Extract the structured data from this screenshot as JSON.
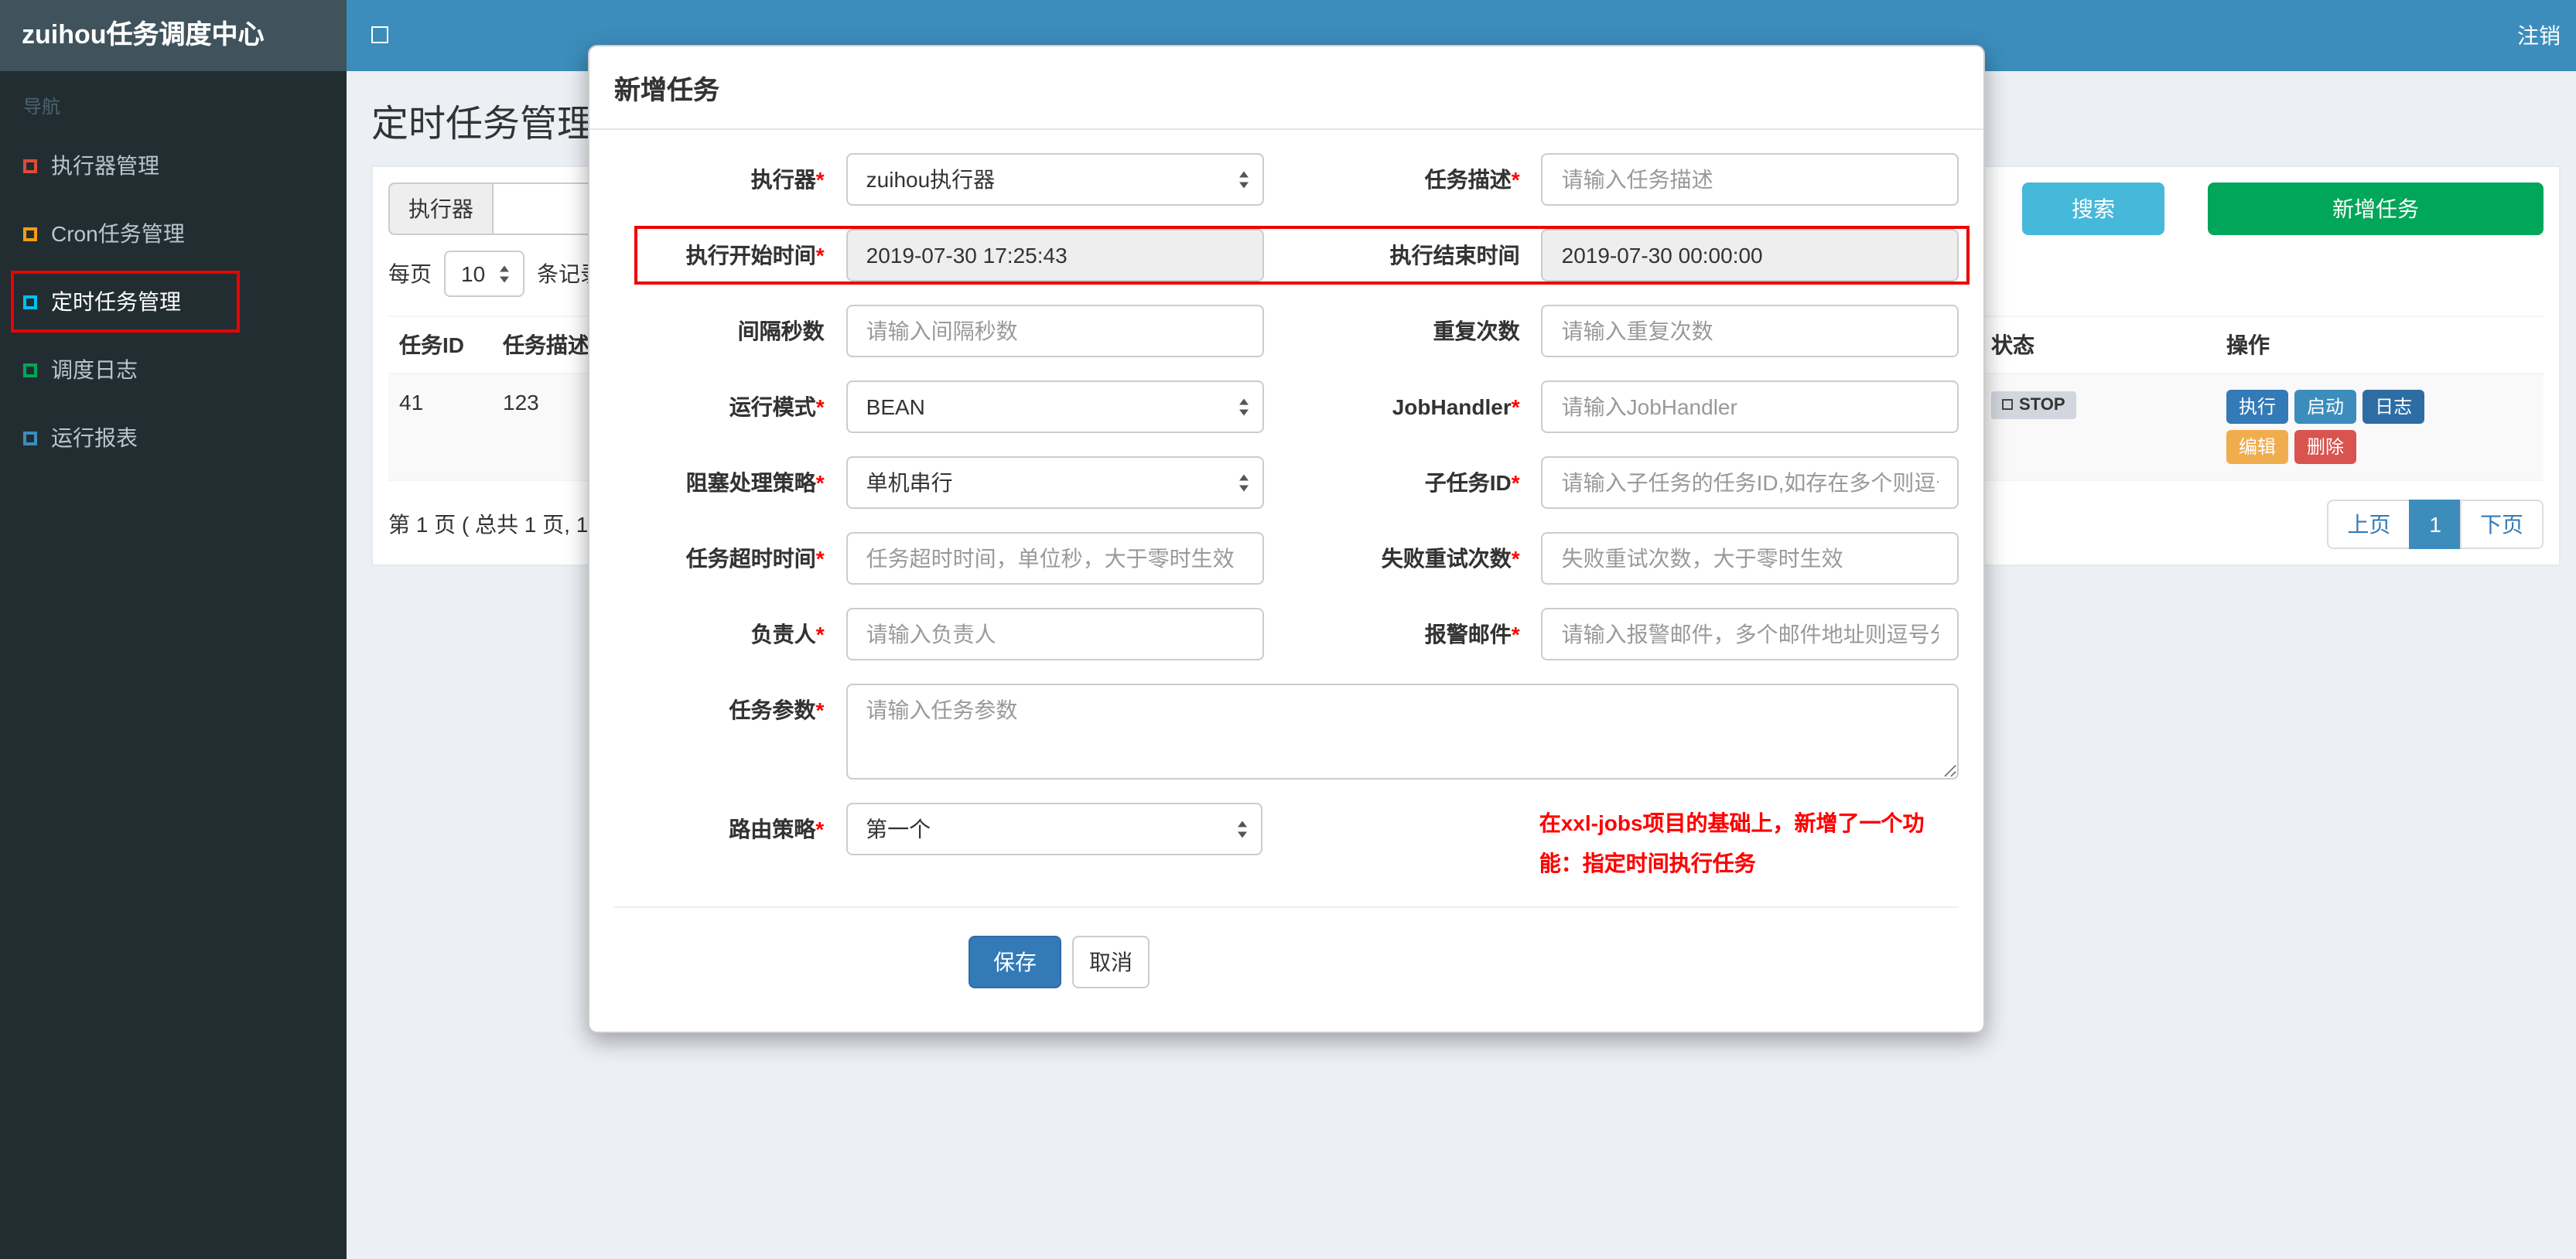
{
  "navbar": {
    "brand": "zuihou任务调度中心",
    "logout": "注销"
  },
  "sidebar": {
    "section": "导航",
    "items": [
      {
        "label": "执行器管理"
      },
      {
        "label": "Cron任务管理"
      },
      {
        "label": "定时任务管理"
      },
      {
        "label": "调度日志"
      },
      {
        "label": "运行报表"
      }
    ]
  },
  "page": {
    "title": "定时任务管理",
    "toolbar": {
      "executor_addon": "执行器",
      "search": "搜索",
      "add_task": "新增任务"
    },
    "page_size": {
      "prefix": "每页",
      "value": "10",
      "suffix": "条记录"
    },
    "table": {
      "col_task_id": "任务ID",
      "col_task_desc": "任务描述",
      "col_status": "状态",
      "col_actions": "操作",
      "row": {
        "task_id": "41",
        "task_desc": "123",
        "status": "STOP",
        "btn_execute": "执行",
        "btn_start": "启动",
        "btn_log": "日志",
        "btn_edit": "编辑",
        "btn_delete": "删除"
      }
    },
    "pagination": {
      "summary": "第 1 页 ( 总共 1 页, 1",
      "prev": "上页",
      "current": "1",
      "next": "下页"
    }
  },
  "modal": {
    "title": "新增任务",
    "fields": {
      "executor": {
        "label": "执行器",
        "req": "*",
        "value": "zuihou执行器"
      },
      "task_desc": {
        "label": "任务描述",
        "req": "*",
        "placeholder": "请输入任务描述"
      },
      "start_time": {
        "label": "执行开始时间",
        "req": "*",
        "value": "2019-07-30 17:25:43"
      },
      "end_time": {
        "label": "执行结束时间",
        "req": "",
        "value": "2019-07-30 00:00:00"
      },
      "interval": {
        "label": "间隔秒数",
        "req": "",
        "placeholder": "请输入间隔秒数"
      },
      "repeat_count": {
        "label": "重复次数",
        "req": "",
        "placeholder": "请输入重复次数"
      },
      "glue_type": {
        "label": "运行模式",
        "req": "*",
        "value": "BEAN"
      },
      "job_handler": {
        "label": "JobHandler",
        "req": "*",
        "placeholder": "请输入JobHandler"
      },
      "block_strategy": {
        "label": "阻塞处理策略",
        "req": "*",
        "value": "单机串行"
      },
      "child_job": {
        "label": "子任务ID",
        "req": "*",
        "placeholder": "请输入子任务的任务ID,如存在多个则逗号分隔"
      },
      "timeout": {
        "label": "任务超时时间",
        "req": "*",
        "placeholder": "任务超时时间，单位秒，大于零时生效"
      },
      "fail_retry": {
        "label": "失败重试次数",
        "req": "*",
        "placeholder": "失败重试次数，大于零时生效"
      },
      "owner": {
        "label": "负责人",
        "req": "*",
        "placeholder": "请输入负责人"
      },
      "alarm_email": {
        "label": "报警邮件",
        "req": "*",
        "placeholder": "请输入报警邮件，多个邮件地址则逗号分隔"
      },
      "job_params": {
        "label": "任务参数",
        "req": "*",
        "placeholder": "请输入任务参数"
      },
      "route_strategy": {
        "label": "路由策略",
        "req": "*",
        "value": "第一个"
      }
    },
    "note": "在xxl-jobs项目的基础上，新增了一个功能：指定时间执行任务",
    "buttons": {
      "save": "保存",
      "cancel": "取消"
    }
  },
  "colors": {
    "navbar-bg": "#3c8dbc",
    "brand-bg": "#40535c",
    "sidebar-bg": "#222d32",
    "content-bg": "#ecf0f5",
    "btn-search-bg": "#46b8da",
    "btn-add-bg": "#00a65a",
    "btn-primary-bg": "#337ab7",
    "btn-execute-bg": "#337ab7",
    "btn-start-bg": "#3c8dbc",
    "btn-log-bg": "#2e6da4",
    "btn-edit-bg": "#f0ad4e",
    "btn-delete-bg": "#d9534f",
    "pager-active-bg": "#3c8dbc",
    "icon-executor": "#dd4b39",
    "icon-cron": "#f39c12",
    "icon-timed": "#00c0ef",
    "icon-log": "#00a65a",
    "icon-report": "#3c8dbc",
    "annotation-red": "#ee0000",
    "note-red": "#ff0000",
    "status-badge-bg": "#d2d6de"
  }
}
